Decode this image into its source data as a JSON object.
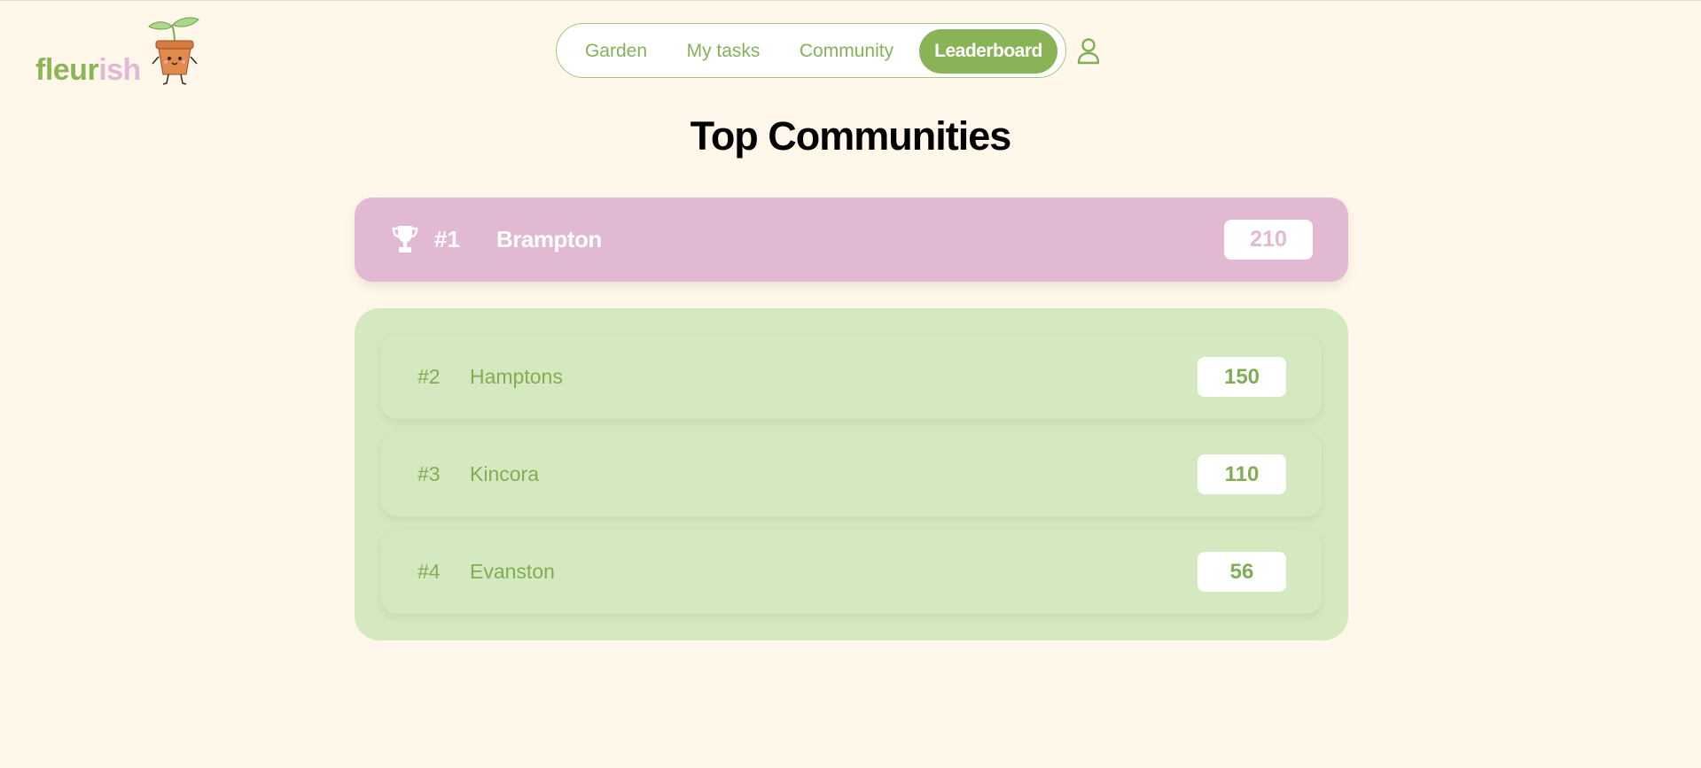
{
  "brand": {
    "name_part1": "fleur",
    "name_part2": "ish",
    "mascot_icon": "potted-sprout-mascot"
  },
  "nav": {
    "items": [
      {
        "label": "Garden"
      },
      {
        "label": "My tasks"
      },
      {
        "label": "Community"
      },
      {
        "label": "Leaderboard",
        "active": true
      }
    ],
    "profile_icon": "user-icon"
  },
  "page": {
    "title": "Top Communities"
  },
  "leaderboard": {
    "first": {
      "rank": "#1",
      "name": "Brampton",
      "score": "210",
      "icon": "trophy-icon"
    },
    "others": [
      {
        "rank": "#2",
        "name": "Hamptons",
        "score": "150"
      },
      {
        "rank": "#3",
        "name": "Kincora",
        "score": "110"
      },
      {
        "rank": "#4",
        "name": "Evanston",
        "score": "56"
      }
    ]
  },
  "colors": {
    "background": "#fff7e9",
    "brand_green": "#8ab357",
    "brand_pink": "#e1b9d3",
    "panel_green": "#d5e9c0"
  }
}
